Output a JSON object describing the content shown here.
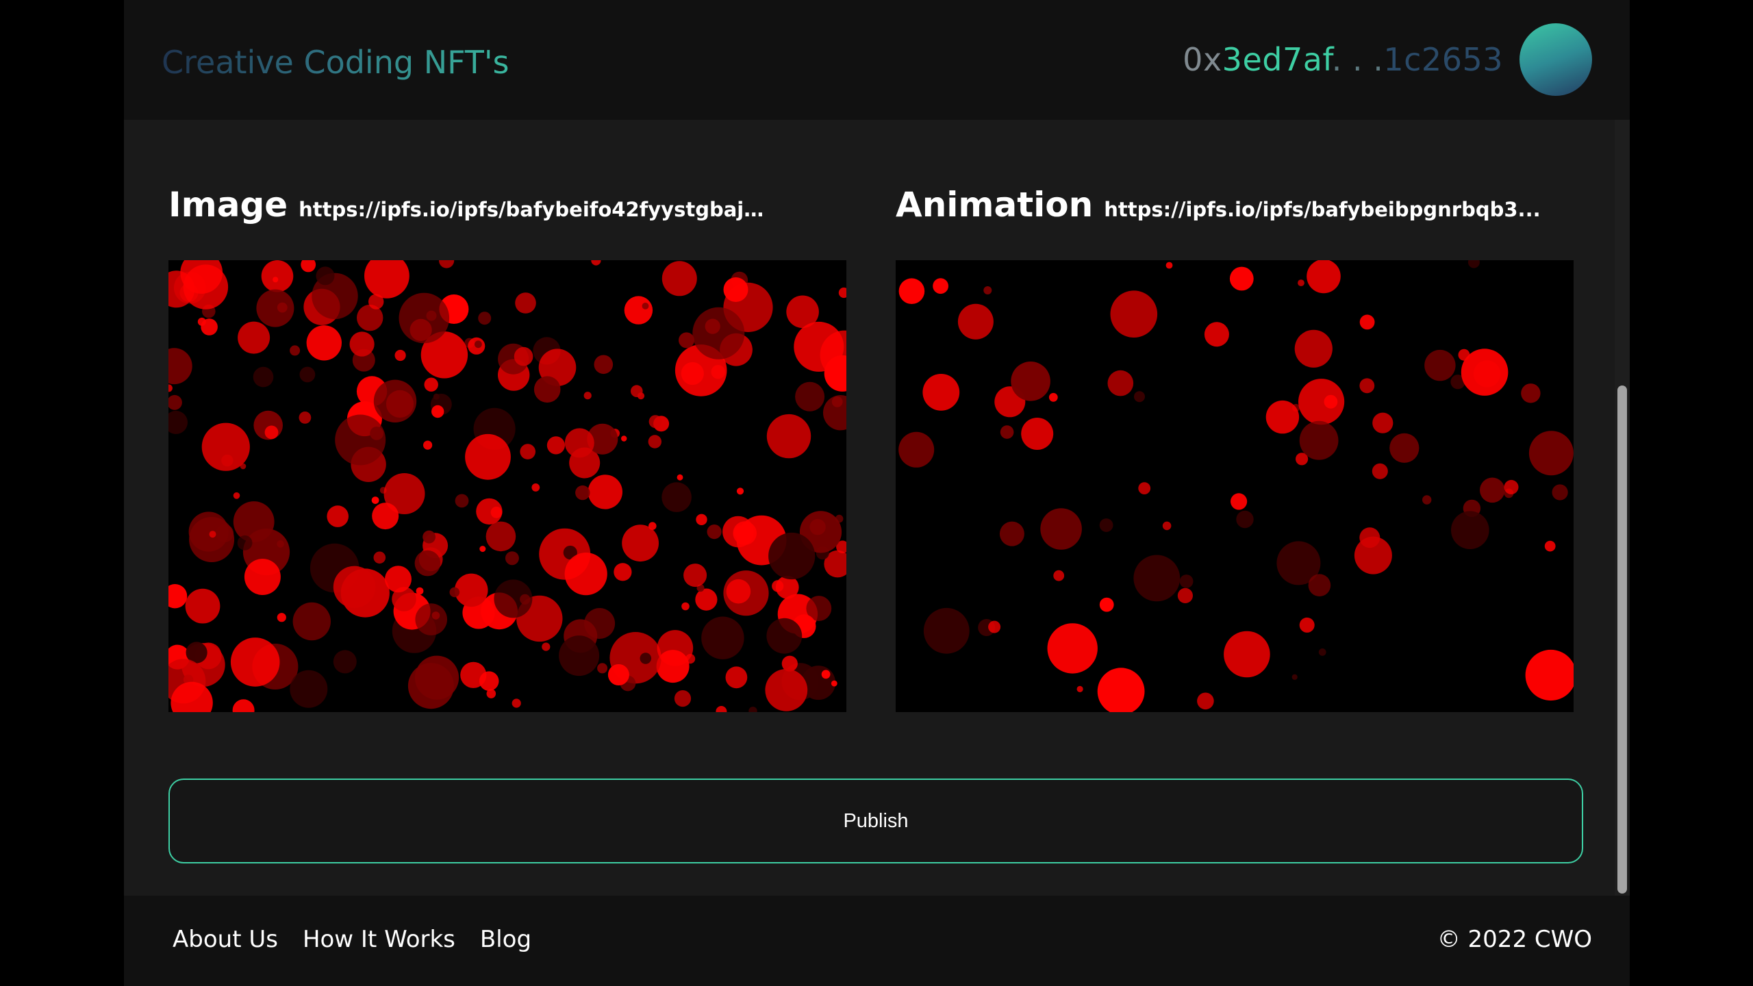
{
  "header": {
    "brand": "Creative Coding NFT's",
    "address_prefix": "0x",
    "address_start": "3ed7af",
    "address_dots": ". . .",
    "address_end": "1c2653"
  },
  "image_panel": {
    "label": "Image",
    "url": "https://ipfs.io/ipfs/bafybeifo42fyystgbajmlw..."
  },
  "animation_panel": {
    "label": "Animation",
    "url": "https://ipfs.io/ipfs/bafybeibpgnrbqb3..."
  },
  "publish": {
    "label": "Publish"
  },
  "footer": {
    "links": [
      "About Us",
      "How It Works",
      "Blog"
    ],
    "copyright": "© 2022 CWO"
  },
  "colors": {
    "accent": "#3ecfa4",
    "background": "#1a1a1a",
    "header_bg": "#111111",
    "dot_bright": "#ff0000",
    "dot_dark": "#5a0000"
  }
}
